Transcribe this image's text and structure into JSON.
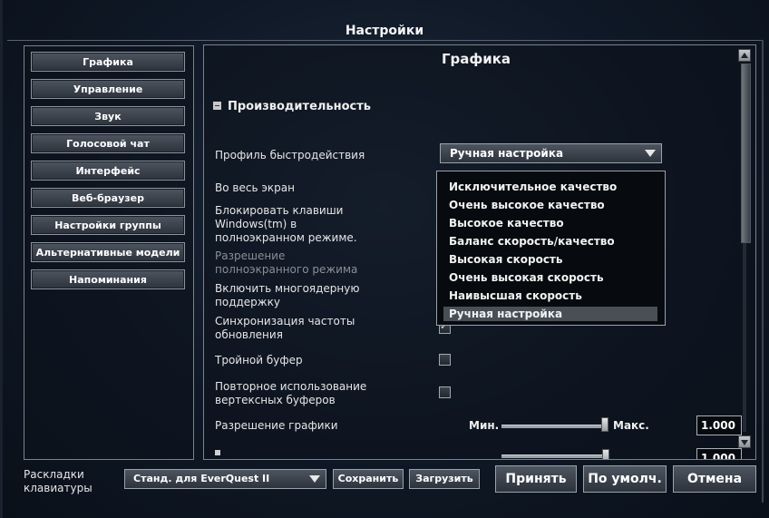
{
  "window": {
    "title": "Настройки"
  },
  "nav": {
    "items": [
      {
        "label": "Графика"
      },
      {
        "label": "Управление"
      },
      {
        "label": "Звук"
      },
      {
        "label": "Голосовой чат"
      },
      {
        "label": "Интерфейс"
      },
      {
        "label": "Веб-браузер"
      },
      {
        "label": "Настройки группы"
      },
      {
        "label": "Альтернативные модели"
      },
      {
        "label": "Напоминания"
      }
    ]
  },
  "main": {
    "title": "Графика",
    "section": "Производительность",
    "rows": {
      "profile": "Профиль быстродействия",
      "fullscreen": "Во весь экран",
      "block_windows_key": "Блокировать клавиши Windows(tm) в полноэкранном режиме.",
      "fullscreen_resolution": "Разрешение полноэкранного режима",
      "multicore": "Включить многоядерную поддержку",
      "vsync": "Синхронизация частоты обновления",
      "triple_buffer": "Тройной буфер",
      "vertex_buffer_reuse": "Повторное использование вертексных буферов",
      "graphics_resolution": "Разрешение графики"
    },
    "profile_combo": {
      "value": "Ручная настройка"
    },
    "profile_options": [
      "Исключительное качество",
      "Очень высокое качество",
      "Высокое качество",
      "Баланс скорость/качество",
      "Высокая скорость",
      "Очень высокая скорость",
      "Наивысшая скорость",
      "Ручная настройка"
    ],
    "selected_option_index": 7,
    "resolution_slider": {
      "min_label": "Мин.",
      "max_label": "Макс.",
      "value": "1.000",
      "level": 1.0
    },
    "partial_row": {
      "value": "1.000"
    }
  },
  "footer": {
    "keymap_label": "Раскладки клавиатуры",
    "keymap_value": "Станд. для EverQuest II",
    "save": "Сохранить",
    "load": "Загрузить",
    "accept": "Принять",
    "default": "По умолч.",
    "cancel": "Отмена"
  }
}
